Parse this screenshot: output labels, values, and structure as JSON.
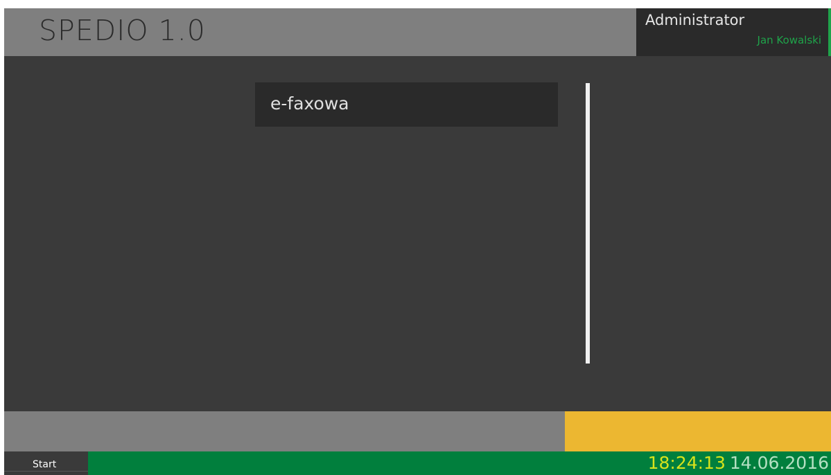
{
  "app": {
    "title": "SPEDIO 1.0"
  },
  "user": {
    "role": "Administrator",
    "name": "Jan Kowalski"
  },
  "main": {
    "tiles": [
      {
        "label": "e-faxowa"
      }
    ]
  },
  "taskbar": {
    "start_label": "Start",
    "time": "18:24:13",
    "date": "14.06.2016"
  },
  "colors": {
    "background": "#3a3a3a",
    "header": "#7f7f7f",
    "accent_green": "#1fa34a",
    "taskbar_green": "#017f3d",
    "yellow_panel": "#ecb731",
    "clock_time": "#d7e21c"
  }
}
